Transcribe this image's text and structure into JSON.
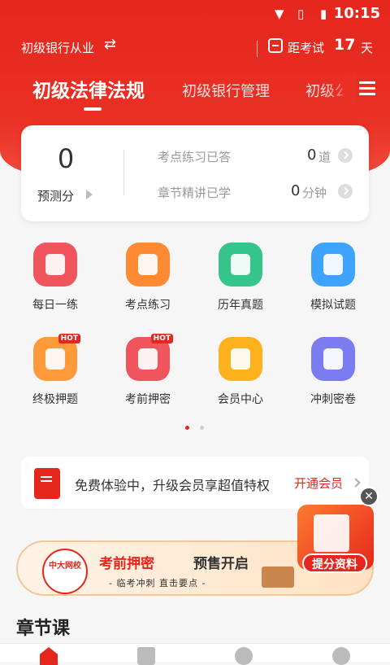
{
  "status_bar": {
    "time": "10:15"
  },
  "top_bar": {
    "bank_selector": "初级银行从业",
    "countdown_prefix": "距考试",
    "countdown_days": "17",
    "countdown_unit": "天"
  },
  "tabs": [
    {
      "label": "初级法律法规",
      "active": true
    },
    {
      "label": "初级银行管理",
      "active": false
    },
    {
      "label": "初级公",
      "active": false
    }
  ],
  "summary": {
    "score_value": "0",
    "score_label": "预测分",
    "stats": [
      {
        "label": "考点练习已答",
        "value": "0",
        "unit": "道"
      },
      {
        "label": "章节精讲已学",
        "value": "0",
        "unit": "分钟"
      }
    ]
  },
  "features": [
    {
      "label": "每日一练",
      "color": "#f0545d",
      "hot": false
    },
    {
      "label": "考点练习",
      "color": "#ff8a34",
      "hot": false
    },
    {
      "label": "历年真题",
      "color": "#35c58a",
      "hot": false
    },
    {
      "label": "模拟试题",
      "color": "#3da3ff",
      "hot": false
    },
    {
      "label": "终极押题",
      "color": "#ff9a3a",
      "hot": true,
      "hot_text": "HOT"
    },
    {
      "label": "考前押密",
      "color": "#f0545d",
      "hot": true,
      "hot_text": "HOT"
    },
    {
      "label": "会员中心",
      "color": "#ffb21e",
      "hot": false
    },
    {
      "label": "冲刺密卷",
      "color": "#7a7cf0",
      "hot": false
    }
  ],
  "pagination": {
    "active_index": 0,
    "count": 2,
    "active_color": "#e5261d",
    "inactive_color": "#cccccc"
  },
  "promo": {
    "text": "免费体验中，升级会员享超值特权",
    "cta": "开通会员"
  },
  "banner": {
    "seal_text": "中大网校",
    "title_red": "考前押密",
    "title_dark": "预售开启",
    "subtitle": "- 临考冲刺  直击要点 -"
  },
  "float_ad": {
    "label": "提分资料",
    "close": "✕"
  },
  "section": {
    "title": "章节课"
  }
}
